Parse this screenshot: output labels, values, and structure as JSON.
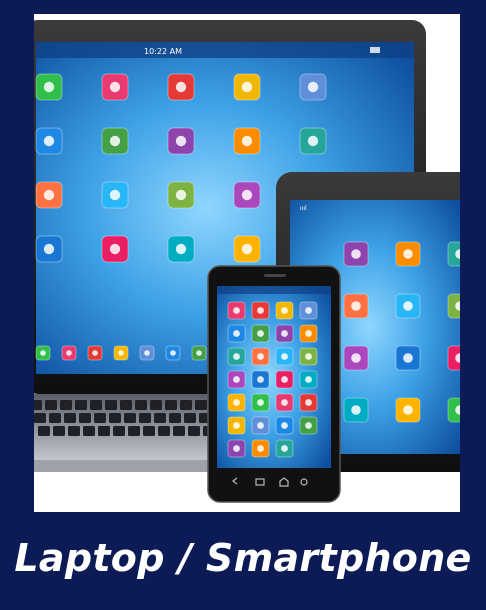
{
  "caption": "Laptop / Smartphone",
  "laptop": {
    "status_time": "10:22 AM"
  },
  "colors": {
    "background": "#0c1a55",
    "caption_text": "#ffffff",
    "screen_blue": "#2f8fd8",
    "device_frame": "#1a1a1a"
  },
  "icons": [
    "chat-icon",
    "home-icon",
    "search-icon",
    "note-icon",
    "film-icon",
    "cloud-icon",
    "headphones-icon",
    "microphone-icon",
    "pin-icon",
    "clock-icon",
    "camera-icon",
    "airplane-icon",
    "cart-icon",
    "mail-icon",
    "globe-icon",
    "settings-icon",
    "wifi-icon",
    "sun-icon"
  ]
}
